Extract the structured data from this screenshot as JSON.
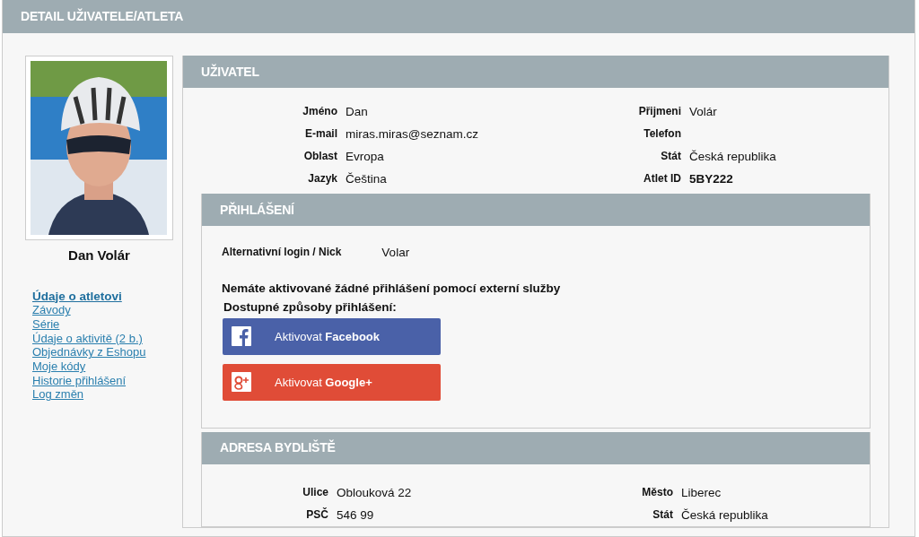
{
  "page_title": "DETAIL UŽIVATELE/ATLETA",
  "profile": {
    "name": "Dan Volár"
  },
  "sidebar": {
    "items": [
      {
        "label": "Údaje o atletovi",
        "selected": true
      },
      {
        "label": "Závody",
        "selected": false
      },
      {
        "label": "Série",
        "selected": false
      },
      {
        "label": "Údaje o aktivitě (2 b.)",
        "selected": false
      },
      {
        "label": "Objednávky z Eshopu",
        "selected": false
      },
      {
        "label": "Moje kódy",
        "selected": false
      },
      {
        "label": "Historie přihlášení",
        "selected": false
      },
      {
        "label": "Log změn",
        "selected": false
      }
    ]
  },
  "user_panel": {
    "title": "UŽIVATEL",
    "fields": [
      {
        "label": "Jméno",
        "value": "Dan",
        "bold": false
      },
      {
        "label": "Přijmeni",
        "value": "Volár",
        "bold": false
      },
      {
        "label": "E-mail",
        "value": "miras.miras@seznam.cz",
        "bold": false
      },
      {
        "label": "Telefon"
      },
      {
        "label": "Oblast",
        "value": "Evropa",
        "bold": false
      },
      {
        "label": "Stát",
        "value": "Česká republika",
        "bold": false
      },
      {
        "label": "Jazyk",
        "value": "Čeština",
        "bold": false
      },
      {
        "label": "Atlet ID",
        "value": "5BY222",
        "bold": true
      }
    ]
  },
  "login_panel": {
    "title": "PŘIHLÁŠENÍ",
    "nick_label": "Alternativní login / Nick",
    "nick_value": "Volar",
    "notice": "Nemáte aktivované žádné přihlášení pomocí externí služby",
    "available": "Dostupné způsoby přihlášení:",
    "buttons": [
      {
        "kind": "facebook",
        "label": "Aktivovat **Facebook**"
      },
      {
        "kind": "google",
        "label": "Aktivovat **Google+**"
      }
    ]
  },
  "address_panel": {
    "title": "ADRESA BYDLIŠTĚ",
    "fields": [
      {
        "label": "Ulice",
        "value": "Oblouková 22",
        "bold": false
      },
      {
        "label": "Město",
        "value": "Liberec",
        "bold": false
      },
      {
        "label": "PSČ",
        "value": "546 99",
        "bold": false
      },
      {
        "label": "Stát",
        "value": "Česká republika",
        "bold": false
      }
    ]
  }
}
